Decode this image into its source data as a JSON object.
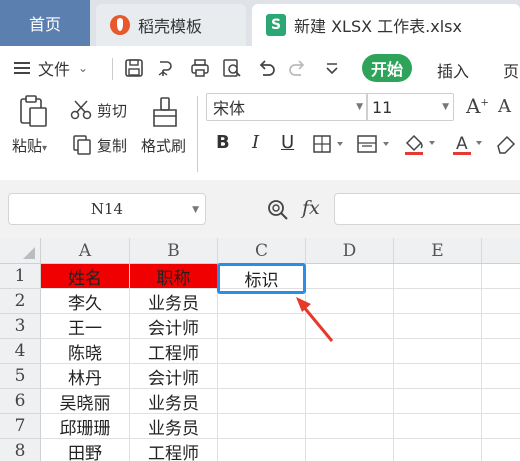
{
  "tabs": {
    "home": "首页",
    "template": "稻壳模板",
    "file": "新建 XLSX 工作表.xlsx"
  },
  "menu": {
    "file": "文件",
    "start": "开始",
    "insert": "插入",
    "page": "页"
  },
  "ribbon": {
    "paste": "粘贴",
    "cut": "剪切",
    "copy": "复制",
    "format_painter": "格式刷",
    "font_name": "宋体",
    "font_size": "11",
    "bold": "B",
    "italic": "I",
    "underline": "U",
    "font_color_letter": "A",
    "grow_letter": "A",
    "shrink_letter": "A"
  },
  "formula_bar": {
    "cell_ref": "N14",
    "fx": "fx",
    "formula": ""
  },
  "sheet": {
    "columns": [
      "A",
      "B",
      "C",
      "D",
      "E"
    ],
    "rows": [
      "1",
      "2",
      "3",
      "4",
      "5",
      "6",
      "7",
      "8"
    ],
    "header": [
      "姓名",
      "职称"
    ],
    "data": [
      [
        "李久",
        "业务员"
      ],
      [
        "王一",
        "会计师"
      ],
      [
        "陈晓",
        "工程师"
      ],
      [
        "林丹",
        "会计师"
      ],
      [
        "吴晓丽",
        "业务员"
      ],
      [
        "邱珊珊",
        "业务员"
      ],
      [
        "田野",
        "工程师"
      ]
    ],
    "selected_cell_text": "标识",
    "header_fill": "#f00000",
    "selection_color": "#2a8ee8",
    "arrow_color": "#e8382a"
  }
}
